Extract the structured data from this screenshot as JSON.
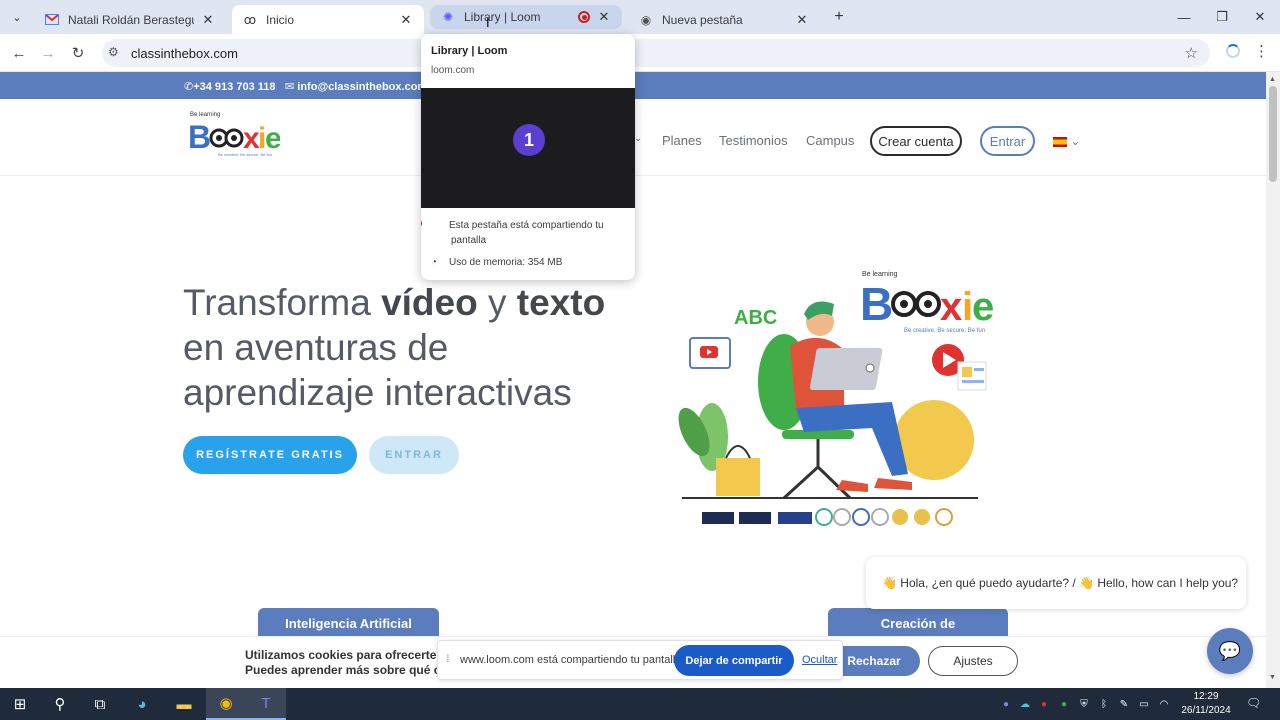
{
  "browser": {
    "tabs": [
      {
        "title": "Natali Roldán Berastegui a dem",
        "favicon": "gmail-icon"
      },
      {
        "title": "Inicio",
        "favicon": "boxie-icon"
      },
      {
        "title": "Library | Loom",
        "favicon": "loom-icon"
      },
      {
        "title": "Nueva pestaña",
        "favicon": "chrome-icon"
      }
    ],
    "url": "classinthebox.com"
  },
  "hovercard": {
    "title": "Library | Loom",
    "url": "loom.com",
    "badge": "1",
    "sharing": "Esta pestaña está compartiendo tu pantalla",
    "memory": "Uso de memoria: 354 MB"
  },
  "site": {
    "phone": "+34 913 703 118",
    "email": "info@classinthebox.com",
    "logo": {
      "small": "Be learning",
      "word": "Boxie",
      "tag": "Be creative. Be secure. Be fun"
    },
    "nav": {
      "planes": "Planes",
      "testimonios": "Testimonios",
      "campus": "Campus",
      "crear": "Crear cuenta",
      "entrar": "Entrar"
    },
    "hero": {
      "line1a": "Transforma ",
      "line1b": "vídeo",
      "line1c": " y ",
      "line1d": "texto",
      "line2": "en aventuras de",
      "line3": "aprendizaje interactivas",
      "register": "REGÍSTRATE GRATIS",
      "enter": "ENTRAR"
    },
    "illustration": {
      "abc": "ABC",
      "brand_small": "Be learning",
      "brand_word": "Boxie",
      "brand_tag": "Be creative. Be secure. Be fun"
    },
    "cards": {
      "left": "Inteligencia Artificial",
      "right": "Creación de"
    },
    "chat": {
      "message": "👋 Hola, ¿en qué puedo ayudarte? / 👋 Hello, how can I help you?"
    },
    "cookie": {
      "line1": "Utilizamos cookies para ofrecerte la",
      "line2": "Puedes aprender más sobre qué coo",
      "reject": "Rechazar",
      "settings": "Ajustes"
    }
  },
  "share_bar": {
    "text": "www.loom.com está compartiendo tu pantalla.",
    "stop": "Dejar de compartir",
    "hide": "Ocultar"
  },
  "taskbar": {
    "time": "12:29",
    "date": "26/11/2024"
  },
  "colors": {
    "brand_blue": "#5b7cbd",
    "cta_blue": "#28a2ea",
    "record_red": "#c5221f"
  }
}
